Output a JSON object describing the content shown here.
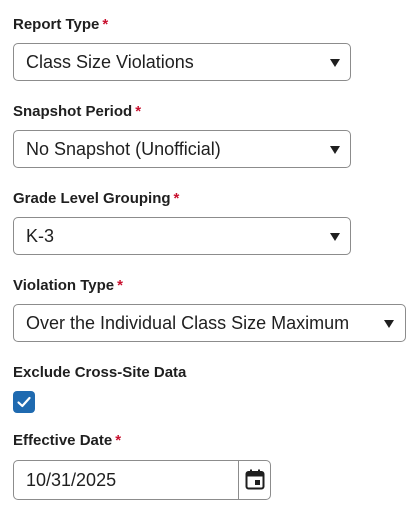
{
  "form": {
    "required_marker": "*",
    "report_type": {
      "label": "Report Type",
      "value": "Class Size Violations"
    },
    "snapshot_period": {
      "label": "Snapshot Period",
      "value": "No Snapshot (Unofficial)"
    },
    "grade_level_grouping": {
      "label": "Grade Level Grouping",
      "value": "K-3"
    },
    "violation_type": {
      "label": "Violation Type",
      "value": "Over the Individual Class Size Maximum"
    },
    "exclude_cross_site": {
      "label": "Exclude Cross-Site Data",
      "checked": true
    },
    "effective_date": {
      "label": "Effective Date",
      "value": "10/31/2025"
    }
  },
  "icons": {
    "dropdown": "chevron-down-icon",
    "checkbox_mark": "checkmark-icon",
    "date_picker": "calendar-icon"
  },
  "colors": {
    "required": "#c8102e",
    "checkbox_fill": "#1f6ab0",
    "border": "#8c8c8c",
    "text": "#1f1f1f"
  }
}
